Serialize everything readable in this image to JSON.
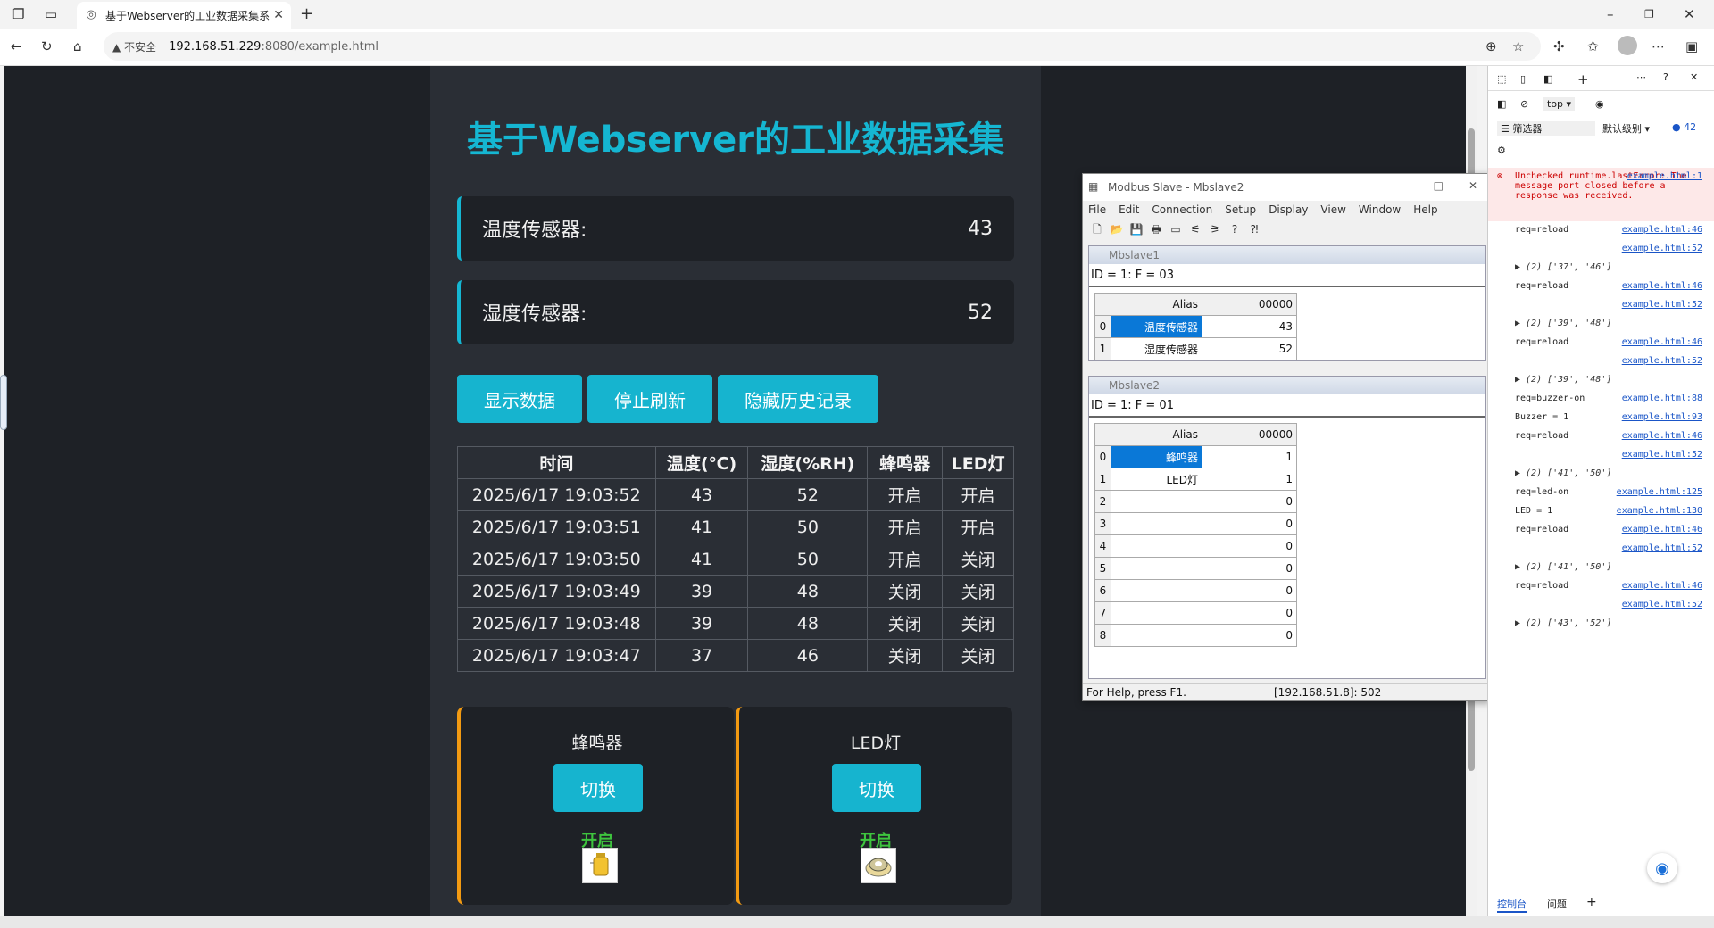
{
  "browser": {
    "tab_title": "基于Webserver的工业数据采集系",
    "security_label": "不安全",
    "url_host": "192.168.51.229",
    "url_path": ":8080/example.html"
  },
  "page": {
    "title": "基于Webserver的工业数据采集",
    "sensors": [
      {
        "label": "温度传感器:",
        "value": "43"
      },
      {
        "label": "湿度传感器:",
        "value": "52"
      }
    ],
    "buttons": {
      "show": "显示数据",
      "stop": "停止刷新",
      "hide": "隐藏历史记录"
    },
    "history": {
      "headers": [
        "时间",
        "温度(℃)",
        "湿度(%RH)",
        "蜂鸣器",
        "LED灯"
      ],
      "rows": [
        [
          "2025/6/17 19:03:52",
          "43",
          "52",
          "开启",
          "开启"
        ],
        [
          "2025/6/17 19:03:51",
          "41",
          "50",
          "开启",
          "开启"
        ],
        [
          "2025/6/17 19:03:50",
          "41",
          "50",
          "开启",
          "关闭"
        ],
        [
          "2025/6/17 19:03:49",
          "39",
          "48",
          "关闭",
          "关闭"
        ],
        [
          "2025/6/17 19:03:48",
          "39",
          "48",
          "关闭",
          "关闭"
        ],
        [
          "2025/6/17 19:03:47",
          "37",
          "46",
          "关闭",
          "关闭"
        ]
      ]
    },
    "controls": [
      {
        "name": "蜂鸣器",
        "toggle": "切换",
        "state": "开启",
        "icon": "buzzer-icon"
      },
      {
        "name": "LED灯",
        "toggle": "切换",
        "state": "开启",
        "icon": "led-icon"
      }
    ]
  },
  "modbus": {
    "title": "Modbus Slave - Mbslave2",
    "menu": [
      "File",
      "Edit",
      "Connection",
      "Setup",
      "Display",
      "View",
      "Window",
      "Help"
    ],
    "slave1": {
      "caption": "Mbslave1",
      "header": "ID = 1: F = 03",
      "alias_col": "Alias",
      "addr_col": "00000",
      "rows": [
        [
          "0",
          "温度传感器",
          "43"
        ],
        [
          "1",
          "湿度传感器",
          "52"
        ]
      ]
    },
    "slave2": {
      "caption": "Mbslave2",
      "header": "ID = 1: F = 01",
      "alias_col": "Alias",
      "addr_col": "00000",
      "rows": [
        [
          "0",
          "蜂鸣器",
          "1"
        ],
        [
          "1",
          "LED灯",
          "1"
        ],
        [
          "2",
          "",
          "0"
        ],
        [
          "3",
          "",
          "0"
        ],
        [
          "4",
          "",
          "0"
        ],
        [
          "5",
          "",
          "0"
        ],
        [
          "6",
          "",
          "0"
        ],
        [
          "7",
          "",
          "0"
        ],
        [
          "8",
          "",
          "0"
        ]
      ]
    },
    "status_help": "For Help, press F1.",
    "status_conn": "[192.168.51.8]: 502"
  },
  "devtools": {
    "context": "top",
    "filter": "筛选器",
    "level": "默认级别",
    "count": "42",
    "error": {
      "text": "Unchecked runtime.lastError: The message port closed before a response was received.",
      "src": "example.html:1"
    },
    "lines": [
      {
        "msg": "req=reload",
        "src": "example.html:46"
      },
      {
        "msg": "",
        "src": "example.html:52"
      },
      {
        "msg": "▶ (2) ['37', '46']",
        "src": ""
      },
      {
        "msg": "req=reload",
        "src": "example.html:46"
      },
      {
        "msg": "",
        "src": "example.html:52"
      },
      {
        "msg": "▶ (2) ['39', '48']",
        "src": ""
      },
      {
        "msg": "req=reload",
        "src": "example.html:46"
      },
      {
        "msg": "",
        "src": "example.html:52"
      },
      {
        "msg": "▶ (2) ['39', '48']",
        "src": ""
      },
      {
        "msg": "req=buzzer-on",
        "src": "example.html:88"
      },
      {
        "msg": "Buzzer = 1",
        "src": "example.html:93"
      },
      {
        "msg": "req=reload",
        "src": "example.html:46"
      },
      {
        "msg": "",
        "src": "example.html:52"
      },
      {
        "msg": "▶ (2) ['41', '50']",
        "src": ""
      },
      {
        "msg": "req=led-on",
        "src": "example.html:125"
      },
      {
        "msg": "LED = 1",
        "src": "example.html:130"
      },
      {
        "msg": "req=reload",
        "src": "example.html:46"
      },
      {
        "msg": "",
        "src": "example.html:52"
      },
      {
        "msg": "▶ (2) ['41', '50']",
        "src": ""
      },
      {
        "msg": "req=reload",
        "src": "example.html:46"
      },
      {
        "msg": "",
        "src": "example.html:52"
      },
      {
        "msg": "▶ (2) ['43', '52']",
        "src": ""
      }
    ],
    "bottom_tabs": [
      "控制台",
      "问题"
    ]
  }
}
